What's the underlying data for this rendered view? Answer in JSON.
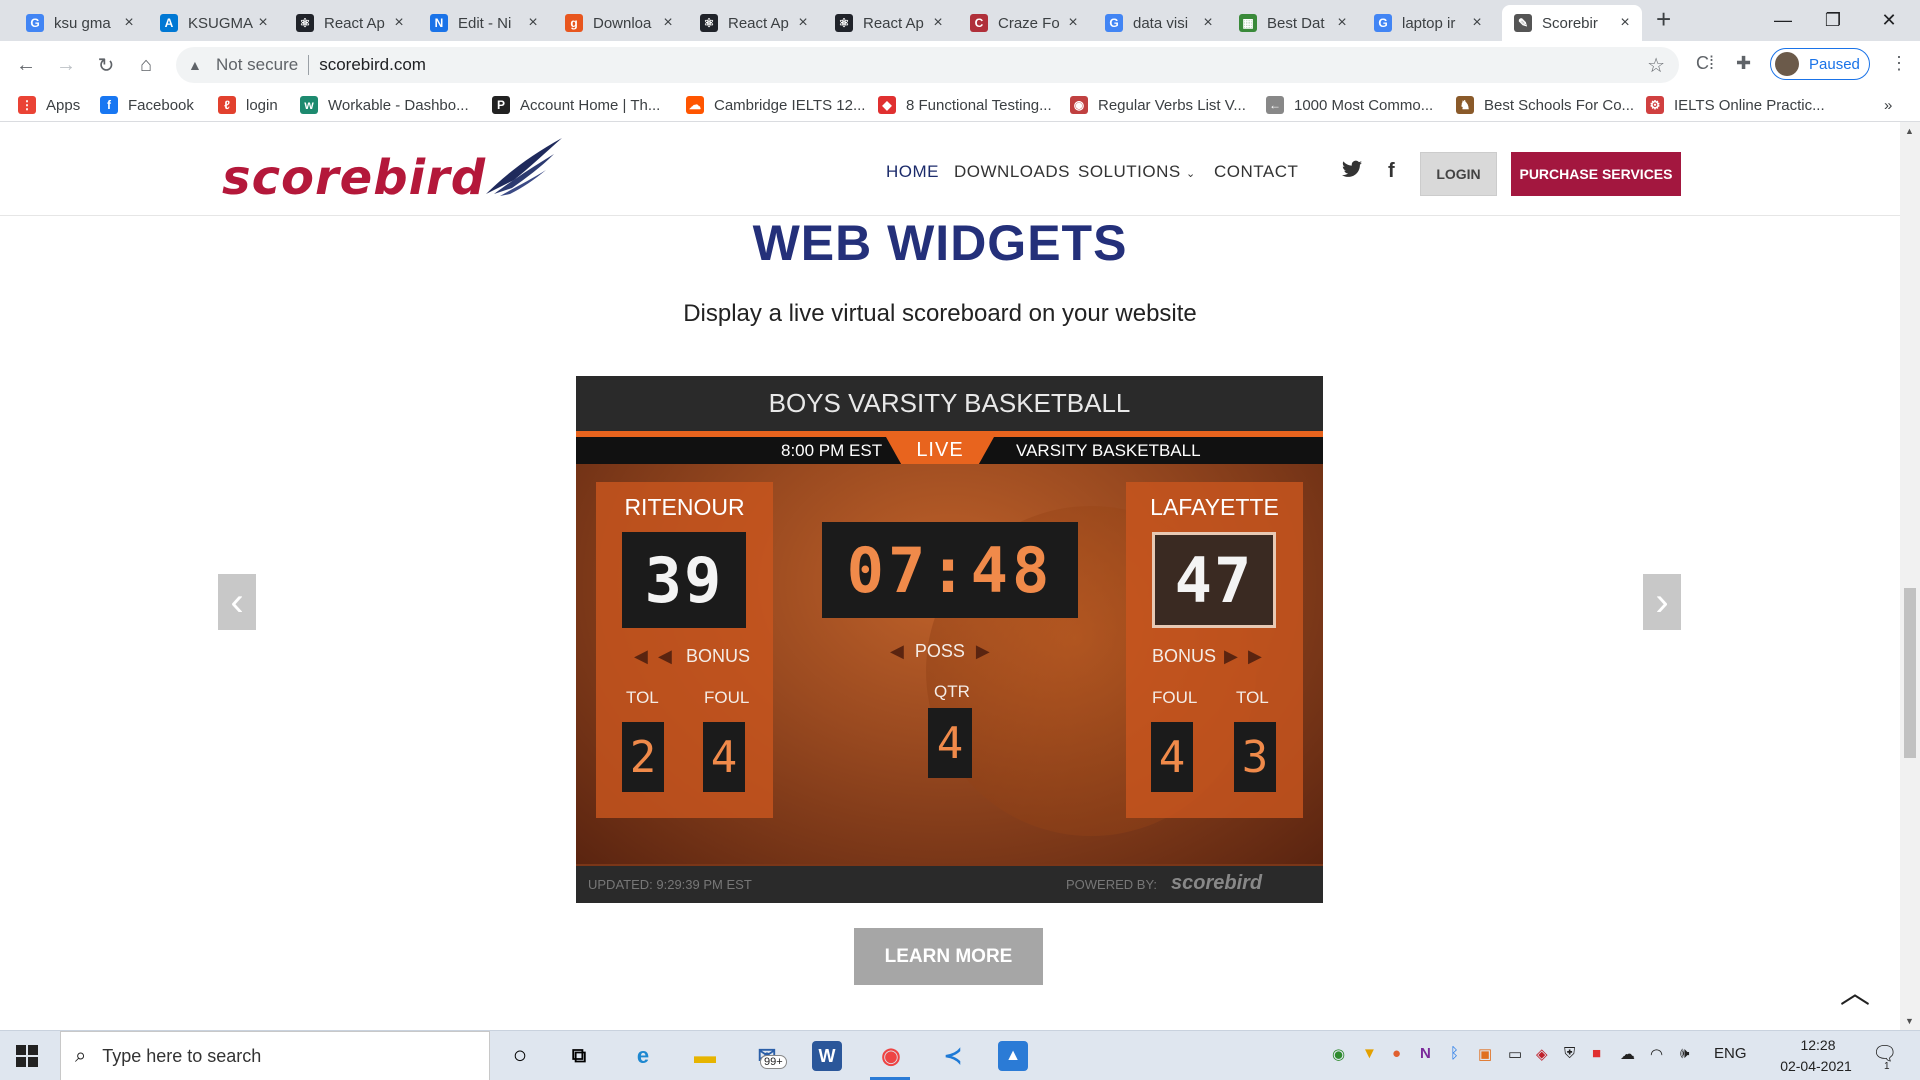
{
  "browser": {
    "tabs": [
      {
        "title": "ksu gma",
        "icon": "google-icon",
        "color": "#4285f4",
        "glyph": "G"
      },
      {
        "title": "KSUGMA",
        "icon": "azure-icon",
        "color": "#0078d4",
        "glyph": "A"
      },
      {
        "title": "React Ap",
        "icon": "react-icon",
        "color": "#20232a",
        "glyph": "⚛"
      },
      {
        "title": "Edit - Ni",
        "icon": "nicepage-icon",
        "color": "#1a73e8",
        "glyph": "N"
      },
      {
        "title": "Downloa",
        "icon": "download-site-icon",
        "color": "#e8561e",
        "glyph": "g"
      },
      {
        "title": "React Ap",
        "icon": "react-icon",
        "color": "#20232a",
        "glyph": "⚛"
      },
      {
        "title": "React Ap",
        "icon": "react-icon",
        "color": "#20232a",
        "glyph": "⚛"
      },
      {
        "title": "Craze Fo",
        "icon": "craze-icon",
        "color": "#b0303a",
        "glyph": "C"
      },
      {
        "title": "data visi",
        "icon": "google-icon",
        "color": "#4285f4",
        "glyph": "G"
      },
      {
        "title": "Best Dat",
        "icon": "grid-icon",
        "color": "#3a8a3a",
        "glyph": "▦"
      },
      {
        "title": "laptop ir",
        "icon": "google-icon",
        "color": "#4285f4",
        "glyph": "G"
      },
      {
        "title": "Scorebir",
        "icon": "scorebird-icon",
        "color": "#555555",
        "glyph": "✎"
      }
    ],
    "url_warning": "Not secure",
    "url": "scorebird.com",
    "profile_label": "Paused",
    "bookmarks": [
      {
        "label": "Apps",
        "icon": "apps-grid-icon",
        "color": "#ea4335",
        "glyph": "⋮"
      },
      {
        "label": "Facebook",
        "icon": "facebook-icon",
        "color": "#1877f2",
        "glyph": "f"
      },
      {
        "label": "login",
        "icon": "login-icon",
        "color": "#e2412e",
        "glyph": "ℓ"
      },
      {
        "label": "Workable - Dashbo...",
        "icon": "workable-icon",
        "color": "#1d8a6f",
        "glyph": "w"
      },
      {
        "label": "Account Home | Th...",
        "icon": "account-icon",
        "color": "#222222",
        "glyph": "P"
      },
      {
        "label": "Cambridge IELTS 12...",
        "icon": "soundcloud-icon",
        "color": "#ff5500",
        "glyph": "☁"
      },
      {
        "label": "8 Functional Testing...",
        "icon": "testing-icon",
        "color": "#e03030",
        "glyph": "◆"
      },
      {
        "label": "Regular Verbs List V...",
        "icon": "verbs-icon",
        "color": "#c04040",
        "glyph": "◉"
      },
      {
        "label": "1000 Most Commo...",
        "icon": "arrow-icon",
        "color": "#888888",
        "glyph": "←"
      },
      {
        "label": "Best Schools For Co...",
        "icon": "owl-icon",
        "color": "#8a5a2a",
        "glyph": "♞"
      },
      {
        "label": "IELTS Online Practic...",
        "icon": "ielts-icon",
        "color": "#d04040",
        "glyph": "⚙"
      }
    ]
  },
  "site": {
    "nav": {
      "home": "HOME",
      "downloads": "DOWNLOADS",
      "solutions": "SOLUTIONS",
      "contact": "CONTACT",
      "login": "LOGIN",
      "purchase": "PURCHASE SERVICES"
    },
    "heading": "WEB WIDGETS",
    "subheading": "Display a live virtual scoreboard on your website",
    "learn_more": "LEARN MORE",
    "brand_color": "#a3173f",
    "heading_color": "#24307a"
  },
  "scoreboard": {
    "title": "BOYS VARSITY BASKETBALL",
    "time": "8:00 PM EST",
    "live": "LIVE",
    "league": "VARSITY BASKETBALL",
    "home": {
      "name": "RITENOUR",
      "score": "39",
      "tol": "2",
      "foul": "4"
    },
    "away": {
      "name": "LAFAYETTE",
      "score": "47",
      "tol": "3",
      "foul": "4"
    },
    "clock": "07:48",
    "poss_label": "POSS",
    "qtr_label": "QTR",
    "qtr": "4",
    "bonus_label": "BONUS",
    "tol_label": "TOL",
    "foul_label": "FOUL",
    "updated": "UPDATED: 9:29:39 PM EST",
    "powered_by": "POWERED BY:"
  },
  "taskbar": {
    "search_placeholder": "Type here to search",
    "mail_badge": "99+",
    "lang": "ENG",
    "time": "12:28",
    "date": "02-04-2021",
    "notification_count": "1"
  }
}
